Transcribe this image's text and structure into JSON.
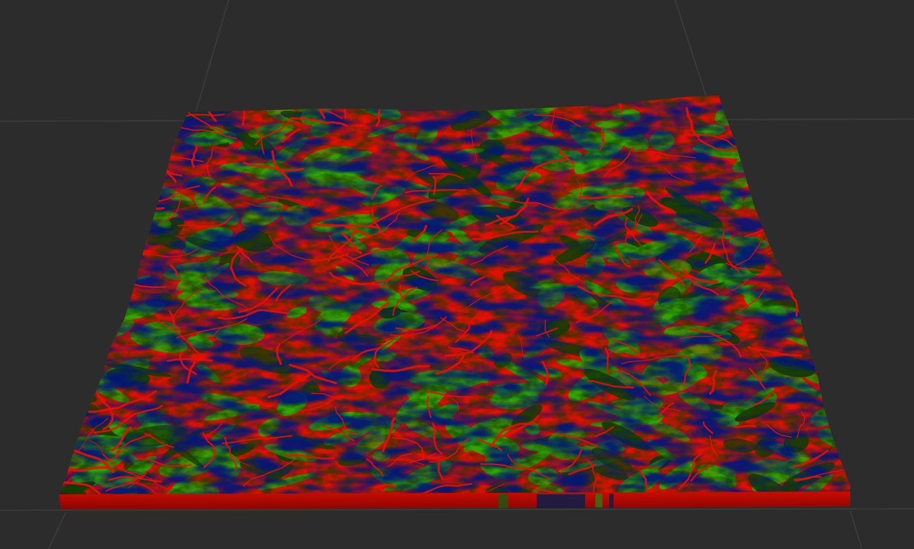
{
  "viewport": {
    "background_color": "#2c2c2c",
    "grid_line_color": "#3a3a3a"
  },
  "terrain": {
    "colormap": {
      "ridge_channel": "#e61005",
      "vegetated_slope": "#2fa805",
      "dark_slope": "#173d08",
      "deep_valley": "#06167a"
    },
    "skirt_base_color": "#c40a00"
  }
}
